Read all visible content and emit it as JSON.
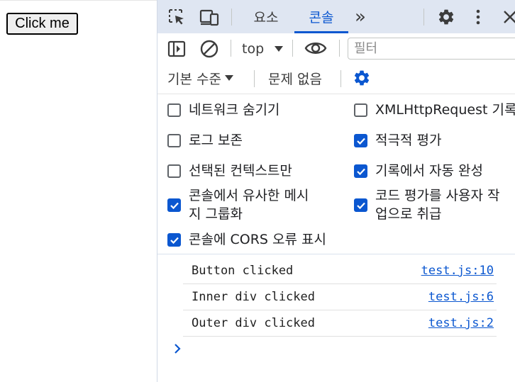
{
  "page": {
    "button_label": "Click me"
  },
  "devtools": {
    "toolbar": {
      "tabs": [
        {
          "label": "요소",
          "active": false
        },
        {
          "label": "콘솔",
          "active": true
        }
      ],
      "more_tabs_glyph": "»",
      "icons": [
        "inspect-element-icon",
        "device-toolbar-icon",
        "more-tabs-icon",
        "settings-gear-icon",
        "more-options-icon",
        "close-icon"
      ]
    },
    "console_toolbar": {
      "context": "top",
      "filter_placeholder": "필터",
      "log_level": "기본 수준",
      "issues": "문제 없음"
    },
    "settings": {
      "left": [
        {
          "label": "네트워크 숨기기",
          "checked": false
        },
        {
          "label": "로그 보존",
          "checked": false
        },
        {
          "label": "선택된 컨텍스트만",
          "checked": false
        },
        {
          "label_line1": "콘솔에서 유사한 메시",
          "label_line2": "지 그룹화",
          "checked": true
        },
        {
          "label": "콘솔에 CORS 오류 표시",
          "checked": true
        }
      ],
      "right": [
        {
          "label": "XMLHttpRequest 기록",
          "checked": false
        },
        {
          "label": "적극적 평가",
          "checked": true
        },
        {
          "label": "기록에서 자동 완성",
          "checked": true
        },
        {
          "label_line1": "코드 평가를 사용자 작",
          "label_line2": "업으로 취급",
          "checked": true
        }
      ]
    },
    "console": {
      "messages": [
        {
          "text": "Button clicked",
          "source": "test.js:10"
        },
        {
          "text": "Inner div clicked",
          "source": "test.js:6"
        },
        {
          "text": "Outer div clicked",
          "source": "test.js:2"
        }
      ],
      "prompt_glyph": "›"
    },
    "colors": {
      "accent": "#0b57d0",
      "toolbar_bg": "#dfe6f2"
    }
  }
}
